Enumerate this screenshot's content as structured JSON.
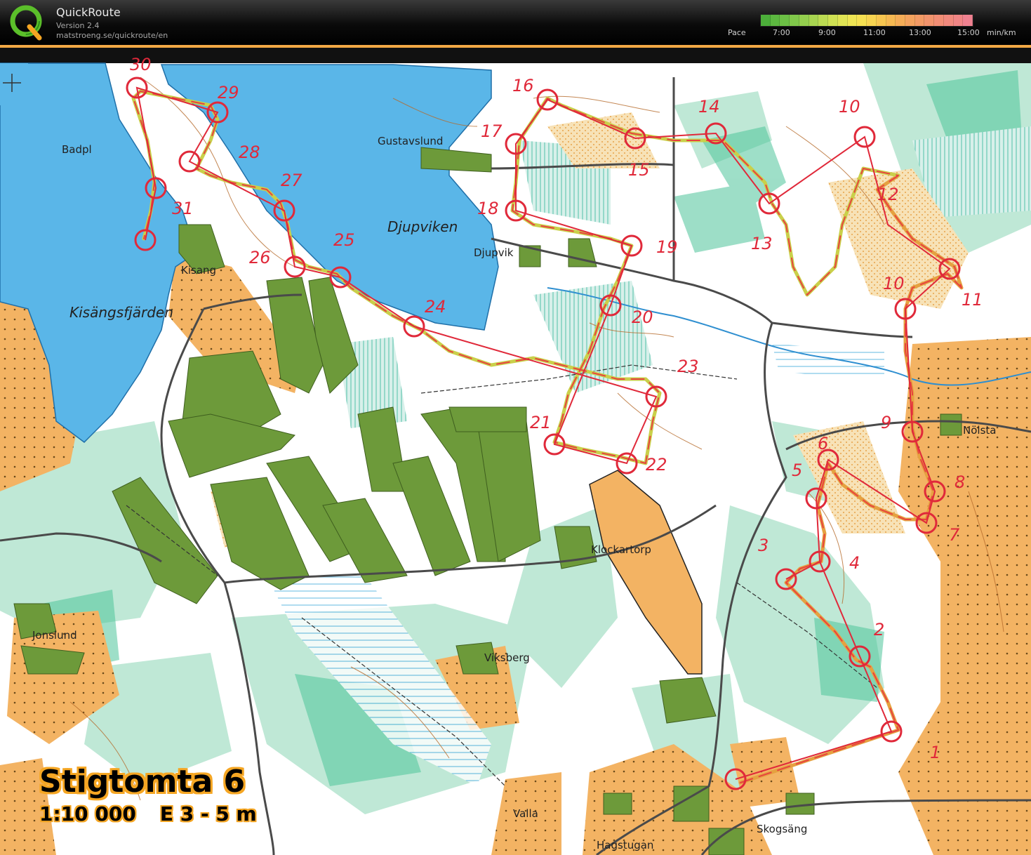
{
  "header": {
    "app_title": "QuickRoute",
    "version": "Version 2.4",
    "url": "matstroeng.se/quickroute/en",
    "pace_label": "Pace",
    "pace_ticks": [
      "7:00",
      "9:00",
      "11:00",
      "13:00",
      "15:00"
    ],
    "pace_unit": "min/km",
    "pace_colors": [
      "#4caf3a",
      "#5cb840",
      "#6cc045",
      "#80c84a",
      "#94cf4e",
      "#a8d550",
      "#bcdb52",
      "#cfe153",
      "#e0e454",
      "#eee554",
      "#f5e052",
      "#f7d451",
      "#f7c650",
      "#f6b952",
      "#f5ad57",
      "#f4a35e",
      "#f39b65",
      "#f2946d",
      "#f28e75",
      "#f1897d",
      "#f08585",
      "#ef8190"
    ]
  },
  "map": {
    "title": "Stigtomta 6",
    "scale": "1:10 000",
    "equidistance": "E 3 - 5 m",
    "place_names": [
      "Badpl",
      "Gustavslund",
      "Djupviken",
      "Djupvik",
      "Kisang",
      "Kisängsfjärden",
      "Nölsta",
      "Klockartorp",
      "Jonslund",
      "Viksberg",
      "Valla",
      "Hagstugan",
      "Skogsäng"
    ],
    "control_numbers": [
      "1",
      "2",
      "3",
      "4",
      "5",
      "6",
      "7",
      "8",
      "9",
      "10",
      "10",
      "11",
      "12",
      "13",
      "14",
      "15",
      "16",
      "17",
      "18",
      "19",
      "20",
      "21",
      "22",
      "23",
      "24",
      "25",
      "26",
      "27",
      "28",
      "29",
      "30",
      "31"
    ]
  }
}
